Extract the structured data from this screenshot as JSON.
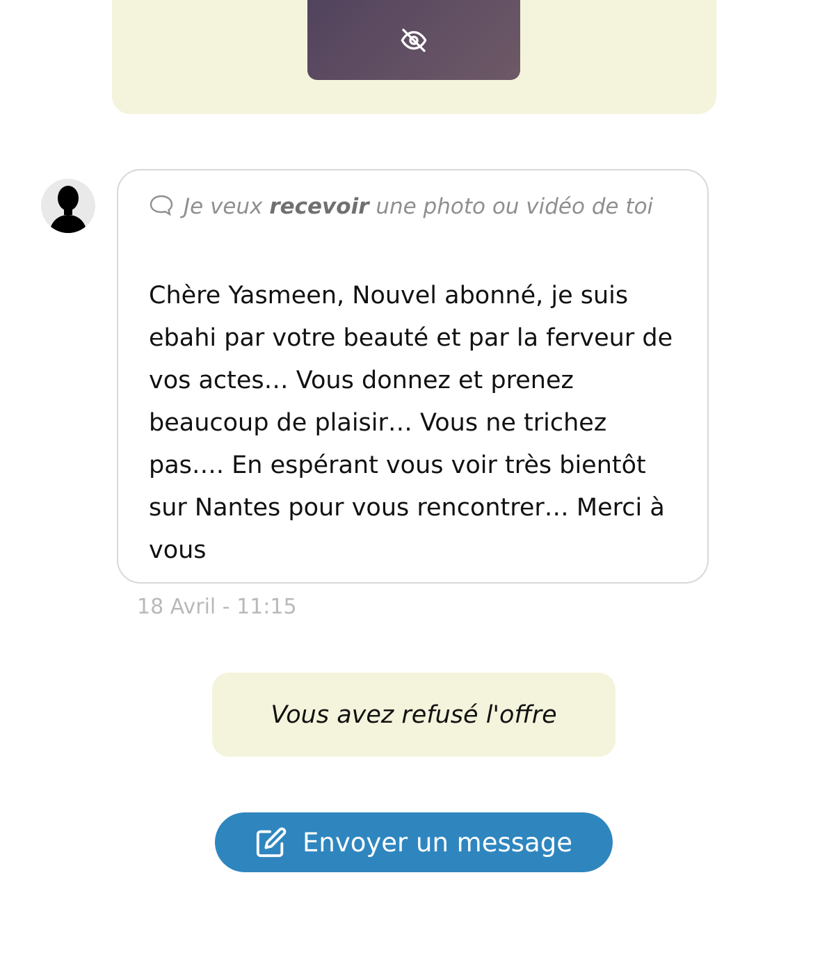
{
  "top_card": {
    "media_note": "",
    "bg_color": "#f4f4dc"
  },
  "request": {
    "header_prefix": "Je veux ",
    "header_bold": "recevoir",
    "header_suffix": " une photo ou vidéo de toi",
    "icon": "speech-bubble-icon",
    "message": "Chère Yasmeen, Nouvel abonné, je suis ebahi par votre beauté et par la ferveur de vos actes… Vous donnez et prenez beaucoup de plaisir… Vous ne trichez pas…. En espérant vous voir très bientôt sur Nantes pour vous rencontrer… Merci à vous",
    "timestamp": "18 Avril - 11:15"
  },
  "status": {
    "refused_label": "Vous avez refusé l'offre"
  },
  "actions": {
    "send_label": "Envoyer un message",
    "send_icon": "edit-icon",
    "accent_color": "#2f86bf"
  }
}
